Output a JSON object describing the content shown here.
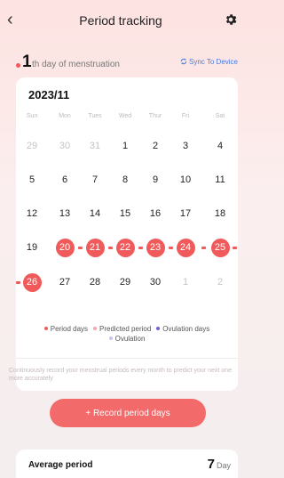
{
  "header": {
    "title": "Period tracking"
  },
  "status": {
    "day_number": "1",
    "day_text": "th day of menstruation",
    "sync_label": "Sync To Device"
  },
  "calendar": {
    "month": "2023/11",
    "weekdays": [
      "Sun",
      "Mon",
      "Tues",
      "Wed",
      "Thur",
      "Fri",
      "Sat"
    ],
    "weeks": [
      [
        {
          "d": "29",
          "f": true
        },
        {
          "d": "30",
          "f": true
        },
        {
          "d": "31",
          "f": true
        },
        {
          "d": "1"
        },
        {
          "d": "2"
        },
        {
          "d": "3"
        },
        {
          "d": "4"
        }
      ],
      [
        {
          "d": "5"
        },
        {
          "d": "6"
        },
        {
          "d": "7"
        },
        {
          "d": "8"
        },
        {
          "d": "9"
        },
        {
          "d": "10"
        },
        {
          "d": "11"
        }
      ],
      [
        {
          "d": "12"
        },
        {
          "d": "13"
        },
        {
          "d": "14"
        },
        {
          "d": "15"
        },
        {
          "d": "16"
        },
        {
          "d": "17"
        },
        {
          "d": "18"
        }
      ],
      [
        {
          "d": "19"
        },
        {
          "d": "20",
          "p": true
        },
        {
          "d": "21",
          "p": true
        },
        {
          "d": "22",
          "p": true
        },
        {
          "d": "23",
          "p": true
        },
        {
          "d": "24",
          "p": true
        },
        {
          "d": "25",
          "p": true
        }
      ],
      [
        {
          "d": "26",
          "p": true
        },
        {
          "d": "27"
        },
        {
          "d": "28"
        },
        {
          "d": "29"
        },
        {
          "d": "30"
        },
        {
          "d": "1",
          "f": true
        },
        {
          "d": "2",
          "f": true
        }
      ]
    ],
    "period_color": "#f05a5a"
  },
  "legend": [
    {
      "label": "Period days",
      "color": "#f05a5a"
    },
    {
      "label": "Predicted period",
      "color": "#f7a6a6"
    },
    {
      "label": "Ovulation days",
      "color": "#6c63d6"
    },
    {
      "label": "Ovulation",
      "color": "#c6c3f0"
    }
  ],
  "note": "Continuously record your menstrual periods every month to predict your next one more accurately",
  "record_button": "+ Record period days",
  "average": {
    "label": "Average period",
    "value": "7",
    "unit": "Day"
  }
}
